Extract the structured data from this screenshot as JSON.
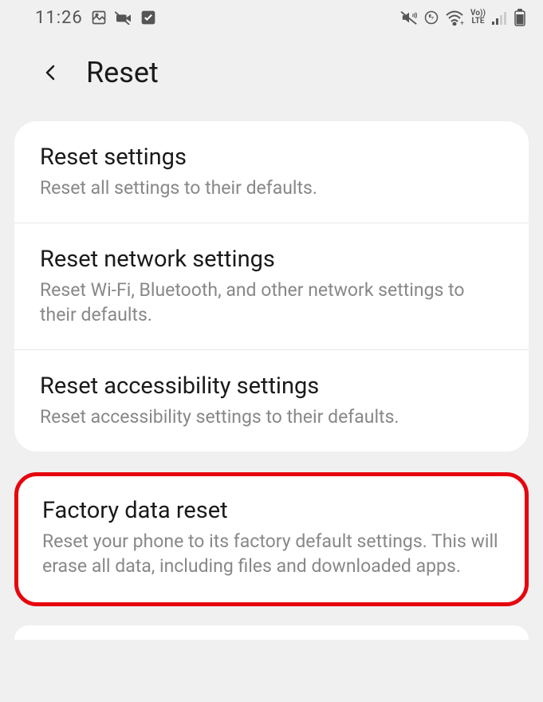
{
  "status_bar": {
    "time": "11:26"
  },
  "header": {
    "title": "Reset"
  },
  "items": [
    {
      "title": "Reset settings",
      "desc": "Reset all settings to their defaults."
    },
    {
      "title": "Reset network settings",
      "desc": "Reset Wi-Fi, Bluetooth, and other network settings to their defaults."
    },
    {
      "title": "Reset accessibility settings",
      "desc": "Reset accessibility settings to their defaults."
    }
  ],
  "highlighted": {
    "title": "Factory data reset",
    "desc": "Reset your phone to its factory default settings. This will erase all data, including files and downloaded apps."
  }
}
